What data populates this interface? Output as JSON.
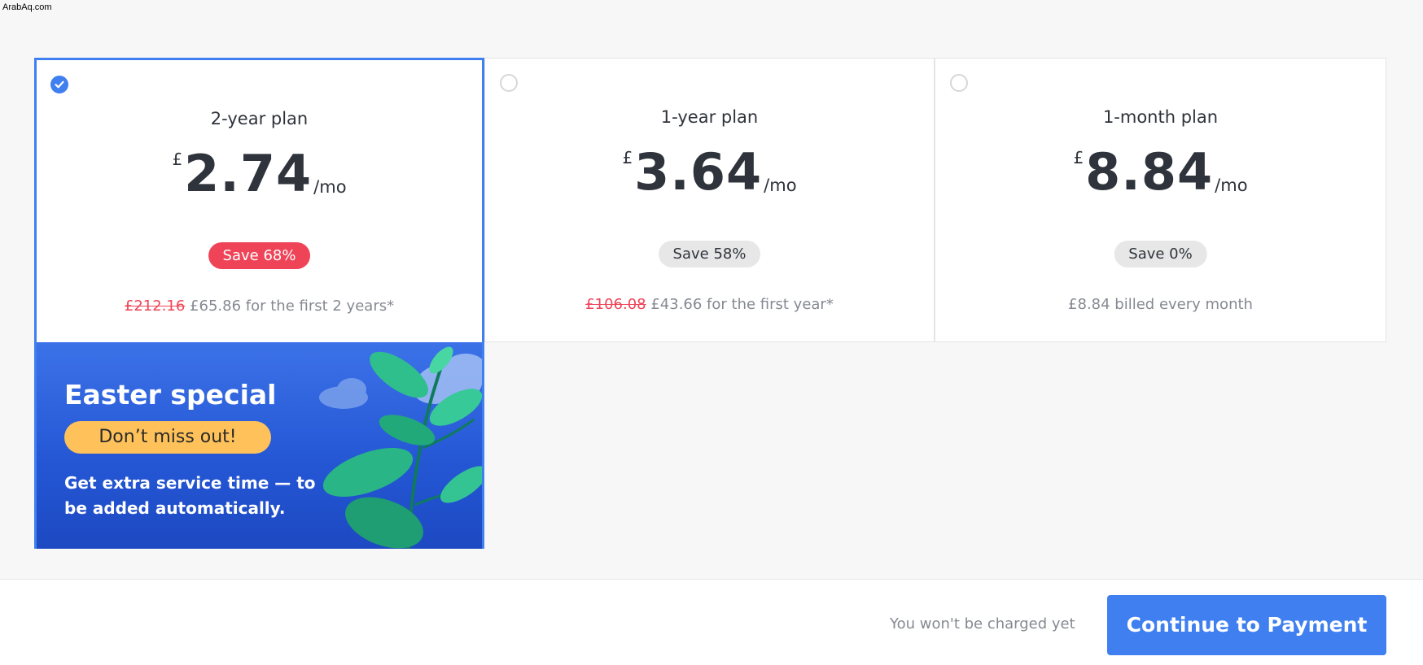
{
  "watermark": "ArabAq.com",
  "plans": [
    {
      "title": "2-year plan",
      "currency": "£",
      "amount": "2.74",
      "per": "/mo",
      "badge": "Save 68%",
      "original_price": "£212.16",
      "billing": " £65.86 for the first 2 years*",
      "selected": true
    },
    {
      "title": "1-year plan",
      "currency": "£",
      "amount": "3.64",
      "per": "/mo",
      "badge": "Save 58%",
      "original_price": "£106.08",
      "billing": " £43.66 for the first year*",
      "selected": false
    },
    {
      "title": "1-month plan",
      "currency": "£",
      "amount": "8.84",
      "per": "/mo",
      "badge": "Save 0%",
      "billing": "£8.84 billed every month",
      "selected": false
    }
  ],
  "promo": {
    "title": "Easter special",
    "pill": "Don’t miss out!",
    "text": "Get extra service time — to be added automatically."
  },
  "footer": {
    "note": "You won't be charged yet",
    "button": "Continue to Payment"
  },
  "colors": {
    "accent": "#3f7ff0",
    "discount_red": "#ef4458",
    "promo_pill": "#ffc25a"
  },
  "icons": {
    "selected_radio": "check-circle-icon",
    "unselected_radio": "empty-circle-icon",
    "promo_art": "plant-and-clouds-illustration"
  }
}
